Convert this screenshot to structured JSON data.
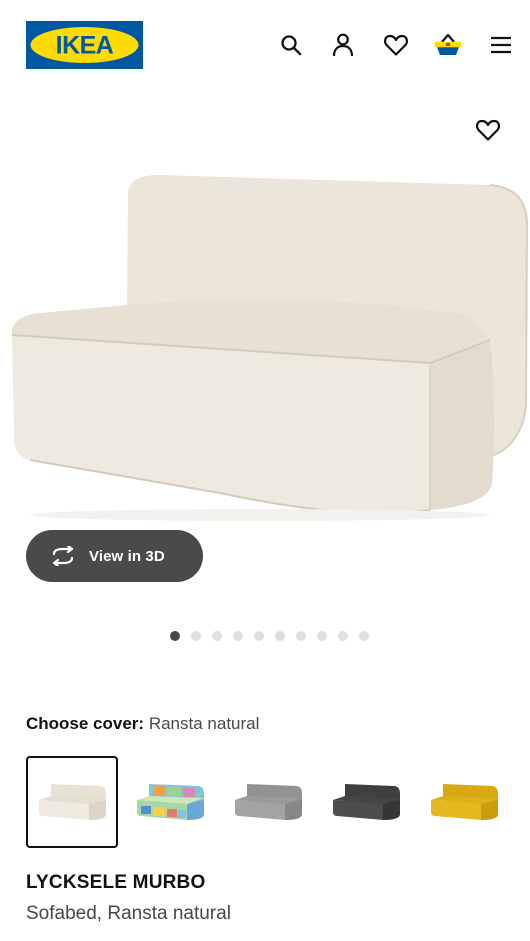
{
  "header": {
    "logo_text": "IKEA",
    "icons": [
      "search-icon",
      "profile-icon",
      "heart-icon",
      "basket-icon",
      "menu-icon"
    ]
  },
  "hero": {
    "favorite_icon": "heart-icon",
    "view_3d_label": "View in 3D",
    "view_3d_icon": "rotate-3d-icon",
    "image_count": 10,
    "active_image": 1
  },
  "cover": {
    "label": "Choose cover:",
    "selected": "Ransta natural",
    "options": [
      {
        "color": "#ebe5d9",
        "selected": true
      },
      {
        "color": "multicolor",
        "selected": false
      },
      {
        "color": "#9c9c9c",
        "selected": false
      },
      {
        "color": "#4a4a4a",
        "selected": false
      },
      {
        "color": "#e1b21f",
        "selected": false
      }
    ]
  },
  "product": {
    "name": "LYCKSELE MURBO",
    "description": "Sofabed, Ransta natural"
  },
  "colors": {
    "brand_blue": "#0058a3",
    "brand_yellow": "#ffdb00",
    "text_dark": "#111111",
    "text_muted": "#484848"
  }
}
